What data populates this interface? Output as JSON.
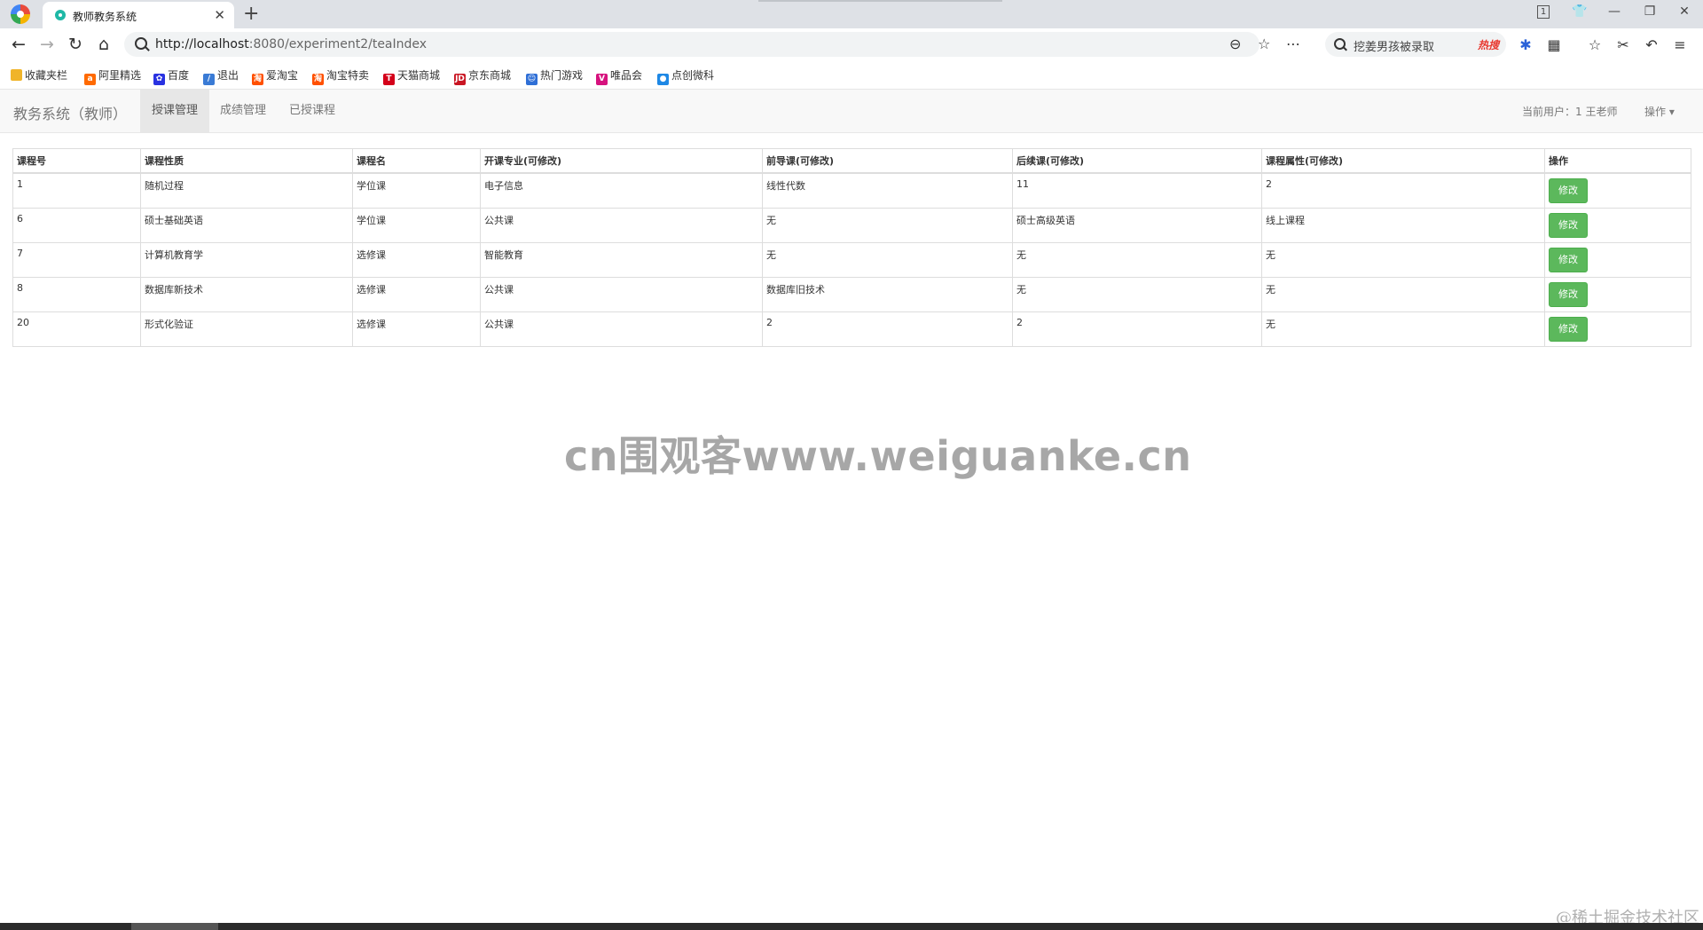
{
  "browser": {
    "tab_title": "教师教务系统",
    "url_host": "http://localhost",
    "url_rest": ":8080/experiment2/teaIndex",
    "search_text": "挖姜男孩被录取",
    "hot_badge": "热搜",
    "window_badge": "1"
  },
  "bookmarks": [
    {
      "label": "收藏夹栏",
      "icon": "folder-icon",
      "color": "#f0b429"
    },
    {
      "label": "阿里精选",
      "icon": "ali-icon",
      "color": "#ff6a00"
    },
    {
      "label": "百度",
      "icon": "baidu-paw-icon",
      "color": "#2932e1"
    },
    {
      "label": "退出",
      "icon": "feather-icon",
      "color": "#3a7bd5"
    },
    {
      "label": "爱淘宝",
      "icon": "taobao-icon",
      "color": "#ff5000"
    },
    {
      "label": "淘宝特卖",
      "icon": "taobao-icon",
      "color": "#ff5000"
    },
    {
      "label": "天猫商城",
      "icon": "tmall-icon",
      "color": "#d4001a"
    },
    {
      "label": "京东商城",
      "icon": "jd-icon",
      "color": "#c91623"
    },
    {
      "label": "热门游戏",
      "icon": "game-icon",
      "color": "#2f6fd6"
    },
    {
      "label": "唯品会",
      "icon": "vip-icon",
      "color": "#d6127e"
    },
    {
      "label": "点创微科",
      "icon": "globe-icon",
      "color": "#1e88e5"
    }
  ],
  "app": {
    "brand": "教务系统（教师）",
    "nav": [
      "授课管理",
      "成绩管理",
      "已授课程"
    ],
    "current_user": "当前用户：1 王老师",
    "ops_label": "操作"
  },
  "table": {
    "headers": [
      "课程号",
      "课程性质",
      "课程名",
      "开课专业(可修改)",
      "前导课(可修改)",
      "后续课(可修改)",
      "课程属性(可修改)",
      "操作"
    ],
    "edit_label": "修改",
    "rows": [
      [
        "1",
        "随机过程",
        "学位课",
        "电子信息",
        "线性代数",
        "11",
        "2"
      ],
      [
        "6",
        "硕士基础英语",
        "学位课",
        "公共课",
        "无",
        "硕士高级英语",
        "线上课程"
      ],
      [
        "7",
        "计算机教育学",
        "选修课",
        "智能教育",
        "无",
        "无",
        "无"
      ],
      [
        "8",
        "数据库新技术",
        "选修课",
        "公共课",
        "数据库旧技术",
        "无",
        "无"
      ],
      [
        "20",
        "形式化验证",
        "选修课",
        "公共课",
        "2",
        "2",
        "无"
      ]
    ]
  },
  "watermark": "cn围观客www.weiguanke.cn",
  "credit": "@稀土掘金技术社区"
}
